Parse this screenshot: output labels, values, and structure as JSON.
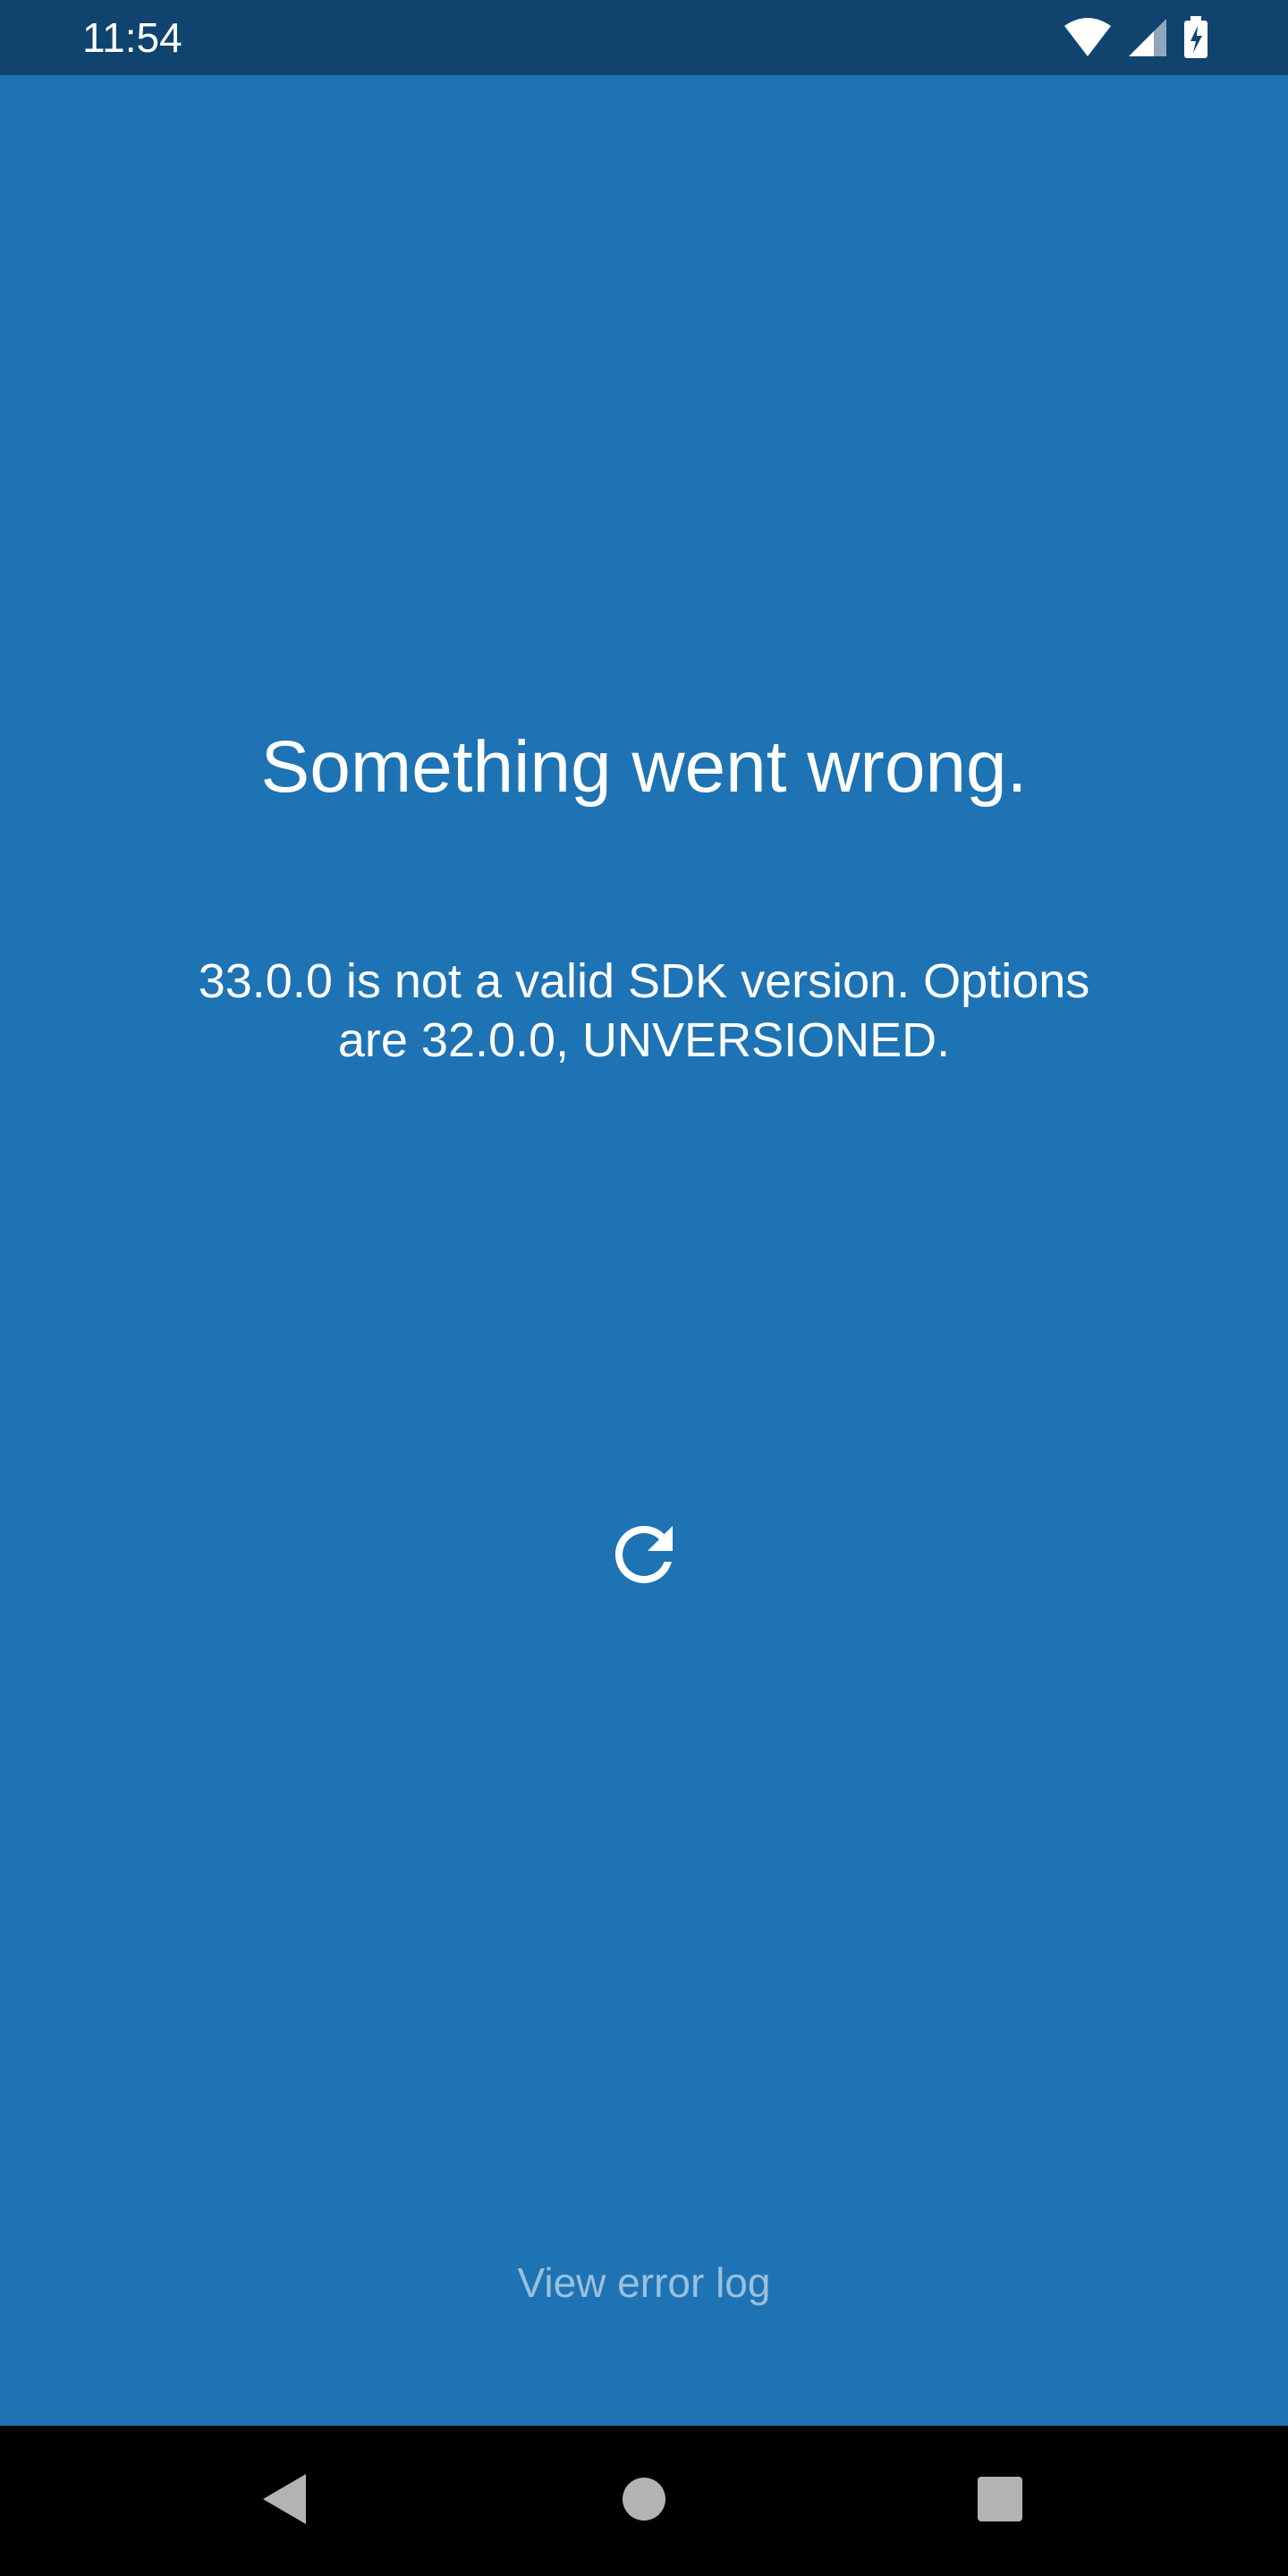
{
  "status_bar": {
    "time": "11:54",
    "icons": [
      "wifi-icon",
      "cell-signal-icon",
      "battery-charging-icon"
    ]
  },
  "error": {
    "title": "Something went wrong.",
    "message": "33.0.0 is not a valid SDK version. Options are 32.0.0, UNVERSIONED.",
    "reload_icon": "reload-icon",
    "view_error_log_label": "View error log"
  },
  "navigation_bar": {
    "buttons": [
      "back-icon",
      "home-icon",
      "recents-icon"
    ]
  },
  "colors": {
    "background": "#1e73b4",
    "status_bar": "#10446f",
    "navigation_bar": "#000000",
    "text": "#ffffff"
  }
}
